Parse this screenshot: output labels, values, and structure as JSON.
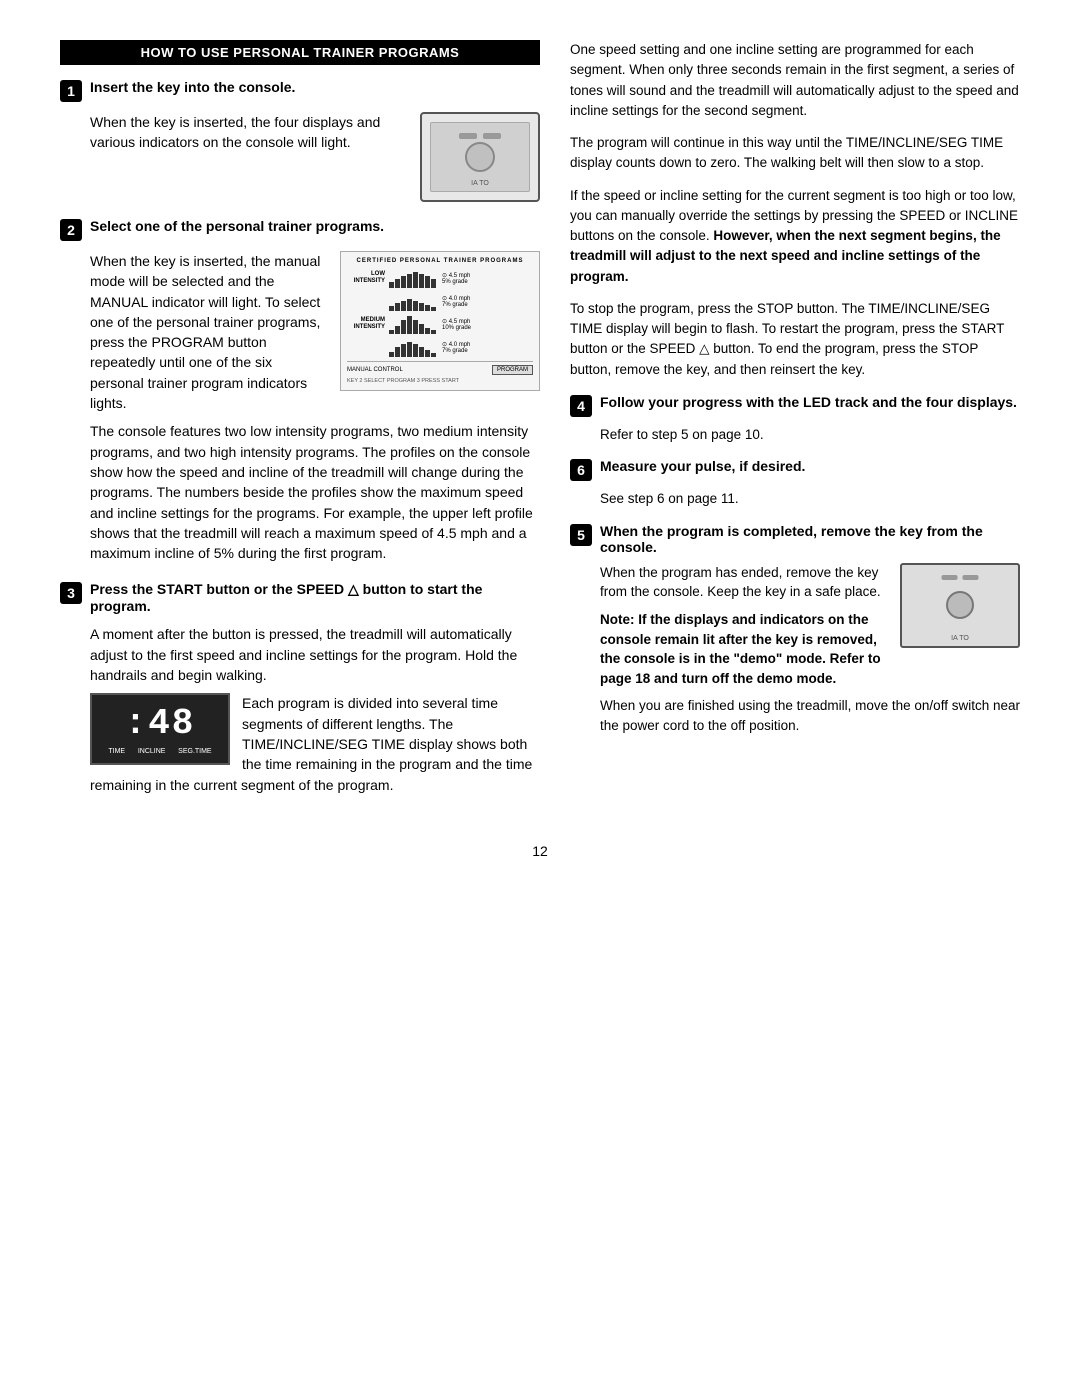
{
  "header": {
    "title": "HOW TO USE PERSONAL TRAINER PROGRAMS"
  },
  "left_col": {
    "step1": {
      "number": "1",
      "title": "Insert the key into the console.",
      "body": "When the key is inserted, the four displays and various indicators on the console will light."
    },
    "step2": {
      "number": "2",
      "title": "Select one of the personal trainer programs.",
      "body_part1": "When the key is inserted, the manual mode will be selected and the MANUAL indicator will light. To select one of the personal trainer programs, press the PROGRAM button repeatedly until one of the six personal trainer program indicators lights.",
      "body_part2": "The console features two low intensity programs, two medium intensity programs, and two high intensity programs. The profiles on the console show how the speed and incline of the treadmill will change during the programs. The numbers beside the profiles show the maximum speed and incline settings for the programs. For example, the upper left profile shows that the treadmill will reach a maximum speed of 4.5 mph and a maximum incline of 5% during the first program."
    },
    "step3": {
      "number": "3",
      "title": "Press the START button or the SPEED △ button to start the program.",
      "body_part1": "A moment after the button is pressed, the treadmill will automatically adjust to the first speed and incline settings for the program. Hold the handrails and begin walking.",
      "body_part2": "Each program is divided into several time segments of different lengths. The TIME/INCLINE/SEG TIME display shows both the time remaining in the program and the time remaining in the current segment of the program."
    }
  },
  "right_col": {
    "para1": "One speed setting and one incline setting are programmed for each segment. When only three seconds remain in the first segment, a series of tones will sound and the treadmill will automatically adjust to the speed and incline settings for the second segment.",
    "para2": "The program will continue in this way until the TIME/INCLINE/SEG TIME display counts down to zero. The walking belt will then slow to a stop.",
    "para3": "If the speed or incline setting for the current segment is too high or too low, you can manually override the settings by pressing the SPEED or INCLINE buttons on the console.",
    "para3_bold": "However, when the next segment begins, the treadmill will adjust to the next speed and incline settings of the program.",
    "para4": "To stop the program, press the STOP button. The TIME/INCLINE/SEG TIME display will begin to flash. To restart the program, press the START button or the SPEED △ button. To end the program, press the STOP button, remove the key, and then reinsert the key.",
    "step4": {
      "number": "4",
      "title": "Follow your progress with the LED track and the four displays.",
      "body": "Refer to step 5 on page 10."
    },
    "step6": {
      "number": "6",
      "title": "Measure your pulse, if desired.",
      "body": "See step 6 on page 11."
    },
    "step5": {
      "number": "5",
      "title": "When the program is completed, remove the key from the console.",
      "body_part1": "When the program has ended, remove the key from the console. Keep the key in a safe place.",
      "note_bold": "Note: If the displays and indicators on the console remain lit after the key is removed, the console is in the \"demo\" mode. Refer to page 18 and turn off the demo mode.",
      "body_part2": "When you are finished using the treadmill, move the on/off switch near the power cord to the off position."
    }
  },
  "page_number": "12",
  "program_panel": {
    "title": "CERTIFIED PERSONAL TRAINER PROGRAMS",
    "low_label": "LOW\nINTENSITY",
    "medium_label": "MEDIUM\nINTENSITY",
    "manual_label": "MANUAL CONTROL",
    "program_btn": "PROGRAM",
    "key_text": "KEY 2 SELECT PROGRAM 3 PRESS START",
    "speed1": "4.5 mph\n5% grade",
    "speed2": "4.0 mph\n7% grade",
    "speed3": "4.5 mph\n10% grade",
    "speed4": "4.0 mph\n7% grade"
  },
  "timer": {
    "digits": ":48",
    "label_time": "TIME",
    "label_incline": "INCLINE",
    "label_seg_time": "SEG.TIME"
  }
}
